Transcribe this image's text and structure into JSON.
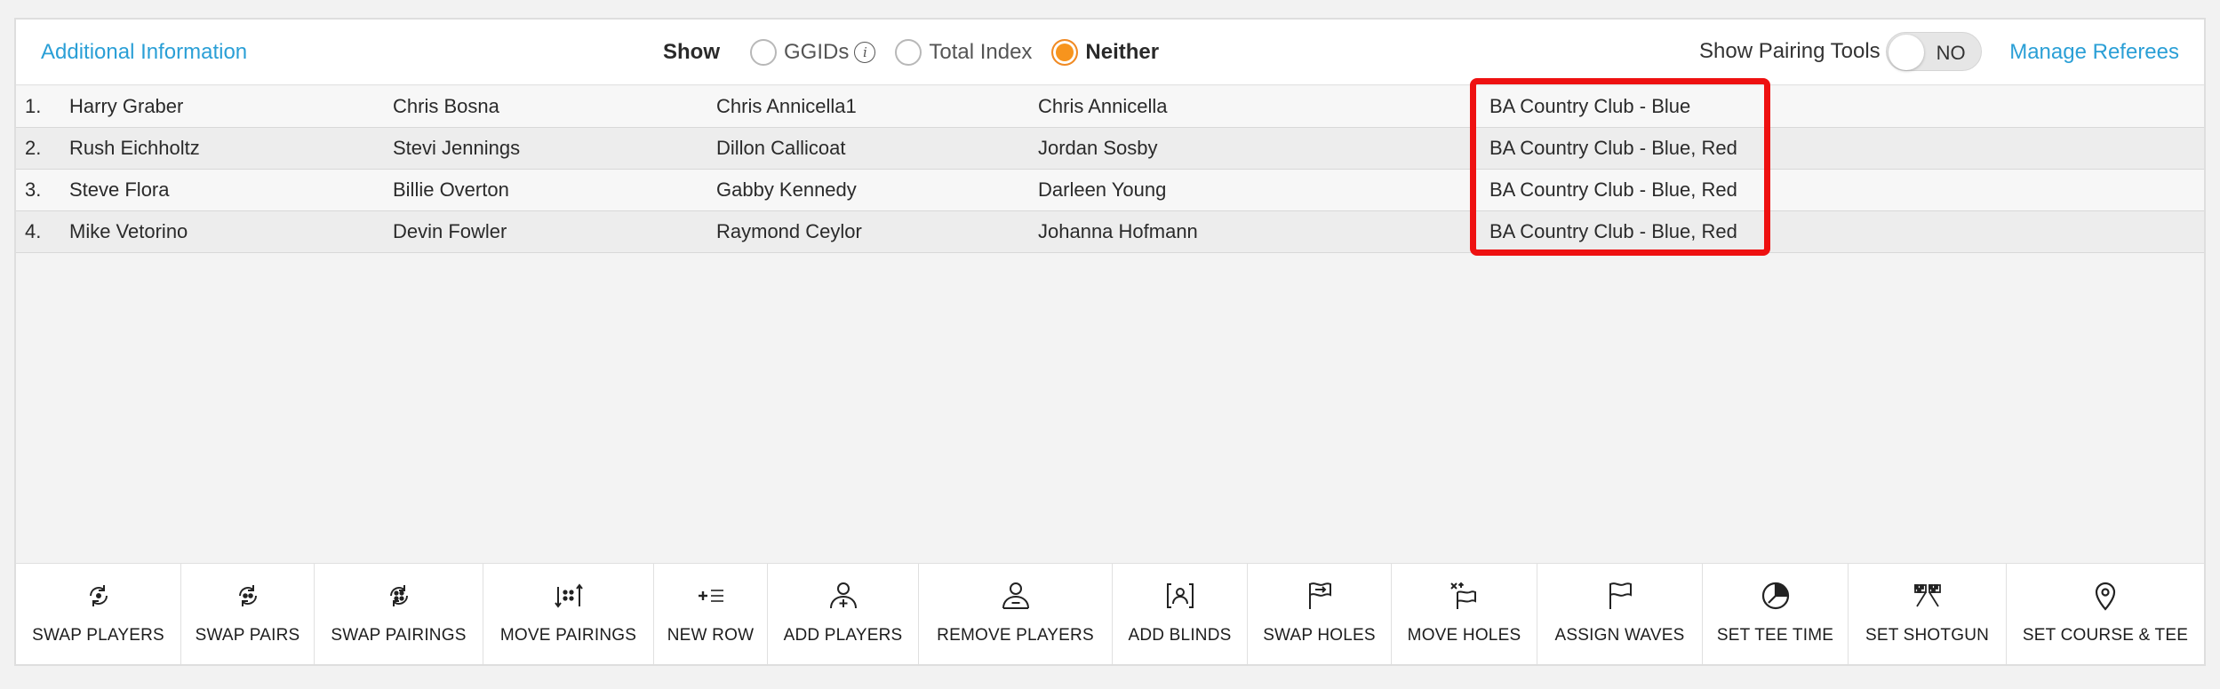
{
  "topbar": {
    "additional_info": "Additional Information",
    "show_label": "Show",
    "options": [
      {
        "label": "GGIDs",
        "selected": false
      },
      {
        "label": "Total Index",
        "selected": false
      },
      {
        "label": "Neither",
        "selected": true
      }
    ],
    "pairing_tools_label": "Show Pairing Tools",
    "pairing_tools_toggle": "NO",
    "manage_referees": "Manage Referees"
  },
  "rows": [
    {
      "num": "1.",
      "p1": "Harry Graber",
      "p2": "Chris Bosna",
      "p3": "Chris Annicella1",
      "p4": "Chris Annicella",
      "course": "BA Country Club - Blue"
    },
    {
      "num": "2.",
      "p1": "Rush Eichholtz",
      "p2": "Stevi Jennings",
      "p3": "Dillon Callicoat",
      "p4": "Jordan Sosby",
      "course": "BA Country Club - Blue, Red"
    },
    {
      "num": "3.",
      "p1": "Steve Flora",
      "p2": "Billie Overton",
      "p3": "Gabby Kennedy",
      "p4": "Darleen Young",
      "course": "BA Country Club - Blue, Red"
    },
    {
      "num": "4.",
      "p1": "Mike Vetorino",
      "p2": "Devin Fowler",
      "p3": "Raymond Ceylor",
      "p4": "Johanna Hofmann",
      "course": "BA Country Club - Blue, Red"
    }
  ],
  "toolbar": [
    {
      "label": "SWAP PLAYERS",
      "icon": "swap-players-icon"
    },
    {
      "label": "SWAP PAIRS",
      "icon": "swap-pairs-icon"
    },
    {
      "label": "SWAP PAIRINGS",
      "icon": "swap-pairings-icon"
    },
    {
      "label": "MOVE PAIRINGS",
      "icon": "move-pairings-icon"
    },
    {
      "label": "NEW ROW",
      "icon": "new-row-icon"
    },
    {
      "label": "ADD PLAYERS",
      "icon": "add-players-icon"
    },
    {
      "label": "REMOVE PLAYERS",
      "icon": "remove-players-icon"
    },
    {
      "label": "ADD BLINDS",
      "icon": "add-blinds-icon"
    },
    {
      "label": "SWAP HOLES",
      "icon": "swap-holes-icon"
    },
    {
      "label": "MOVE HOLES",
      "icon": "move-holes-icon"
    },
    {
      "label": "ASSIGN WAVES",
      "icon": "assign-waves-icon"
    },
    {
      "label": "SET TEE TIME",
      "icon": "set-tee-time-icon"
    },
    {
      "label": "SET SHOTGUN",
      "icon": "set-shotgun-icon"
    },
    {
      "label": "SET COURSE & TEE",
      "icon": "set-course-tee-icon"
    }
  ],
  "colors": {
    "accent": "#2a9fd6",
    "selected_radio": "#f7941d",
    "highlight": "#ee1111"
  }
}
